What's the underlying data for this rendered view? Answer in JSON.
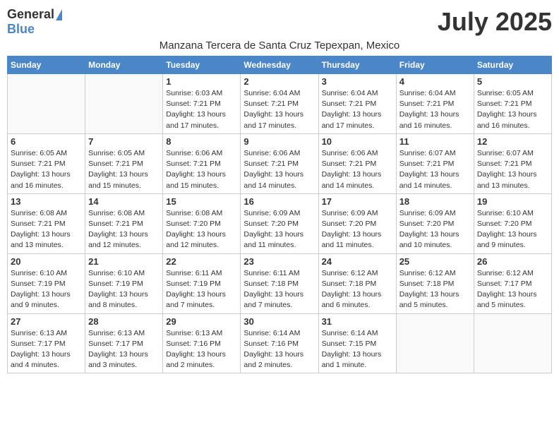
{
  "header": {
    "logo_general": "General",
    "logo_blue": "Blue",
    "month": "July 2025",
    "subtitle": "Manzana Tercera de Santa Cruz Tepexpan, Mexico"
  },
  "days_of_week": [
    "Sunday",
    "Monday",
    "Tuesday",
    "Wednesday",
    "Thursday",
    "Friday",
    "Saturday"
  ],
  "weeks": [
    [
      {
        "day": "",
        "info": ""
      },
      {
        "day": "",
        "info": ""
      },
      {
        "day": "1",
        "info": "Sunrise: 6:03 AM\nSunset: 7:21 PM\nDaylight: 13 hours\nand 17 minutes."
      },
      {
        "day": "2",
        "info": "Sunrise: 6:04 AM\nSunset: 7:21 PM\nDaylight: 13 hours\nand 17 minutes."
      },
      {
        "day": "3",
        "info": "Sunrise: 6:04 AM\nSunset: 7:21 PM\nDaylight: 13 hours\nand 17 minutes."
      },
      {
        "day": "4",
        "info": "Sunrise: 6:04 AM\nSunset: 7:21 PM\nDaylight: 13 hours\nand 16 minutes."
      },
      {
        "day": "5",
        "info": "Sunrise: 6:05 AM\nSunset: 7:21 PM\nDaylight: 13 hours\nand 16 minutes."
      }
    ],
    [
      {
        "day": "6",
        "info": "Sunrise: 6:05 AM\nSunset: 7:21 PM\nDaylight: 13 hours\nand 16 minutes."
      },
      {
        "day": "7",
        "info": "Sunrise: 6:05 AM\nSunset: 7:21 PM\nDaylight: 13 hours\nand 15 minutes."
      },
      {
        "day": "8",
        "info": "Sunrise: 6:06 AM\nSunset: 7:21 PM\nDaylight: 13 hours\nand 15 minutes."
      },
      {
        "day": "9",
        "info": "Sunrise: 6:06 AM\nSunset: 7:21 PM\nDaylight: 13 hours\nand 14 minutes."
      },
      {
        "day": "10",
        "info": "Sunrise: 6:06 AM\nSunset: 7:21 PM\nDaylight: 13 hours\nand 14 minutes."
      },
      {
        "day": "11",
        "info": "Sunrise: 6:07 AM\nSunset: 7:21 PM\nDaylight: 13 hours\nand 14 minutes."
      },
      {
        "day": "12",
        "info": "Sunrise: 6:07 AM\nSunset: 7:21 PM\nDaylight: 13 hours\nand 13 minutes."
      }
    ],
    [
      {
        "day": "13",
        "info": "Sunrise: 6:08 AM\nSunset: 7:21 PM\nDaylight: 13 hours\nand 13 minutes."
      },
      {
        "day": "14",
        "info": "Sunrise: 6:08 AM\nSunset: 7:21 PM\nDaylight: 13 hours\nand 12 minutes."
      },
      {
        "day": "15",
        "info": "Sunrise: 6:08 AM\nSunset: 7:20 PM\nDaylight: 13 hours\nand 12 minutes."
      },
      {
        "day": "16",
        "info": "Sunrise: 6:09 AM\nSunset: 7:20 PM\nDaylight: 13 hours\nand 11 minutes."
      },
      {
        "day": "17",
        "info": "Sunrise: 6:09 AM\nSunset: 7:20 PM\nDaylight: 13 hours\nand 11 minutes."
      },
      {
        "day": "18",
        "info": "Sunrise: 6:09 AM\nSunset: 7:20 PM\nDaylight: 13 hours\nand 10 minutes."
      },
      {
        "day": "19",
        "info": "Sunrise: 6:10 AM\nSunset: 7:20 PM\nDaylight: 13 hours\nand 9 minutes."
      }
    ],
    [
      {
        "day": "20",
        "info": "Sunrise: 6:10 AM\nSunset: 7:19 PM\nDaylight: 13 hours\nand 9 minutes."
      },
      {
        "day": "21",
        "info": "Sunrise: 6:10 AM\nSunset: 7:19 PM\nDaylight: 13 hours\nand 8 minutes."
      },
      {
        "day": "22",
        "info": "Sunrise: 6:11 AM\nSunset: 7:19 PM\nDaylight: 13 hours\nand 7 minutes."
      },
      {
        "day": "23",
        "info": "Sunrise: 6:11 AM\nSunset: 7:18 PM\nDaylight: 13 hours\nand 7 minutes."
      },
      {
        "day": "24",
        "info": "Sunrise: 6:12 AM\nSunset: 7:18 PM\nDaylight: 13 hours\nand 6 minutes."
      },
      {
        "day": "25",
        "info": "Sunrise: 6:12 AM\nSunset: 7:18 PM\nDaylight: 13 hours\nand 5 minutes."
      },
      {
        "day": "26",
        "info": "Sunrise: 6:12 AM\nSunset: 7:17 PM\nDaylight: 13 hours\nand 5 minutes."
      }
    ],
    [
      {
        "day": "27",
        "info": "Sunrise: 6:13 AM\nSunset: 7:17 PM\nDaylight: 13 hours\nand 4 minutes."
      },
      {
        "day": "28",
        "info": "Sunrise: 6:13 AM\nSunset: 7:17 PM\nDaylight: 13 hours\nand 3 minutes."
      },
      {
        "day": "29",
        "info": "Sunrise: 6:13 AM\nSunset: 7:16 PM\nDaylight: 13 hours\nand 2 minutes."
      },
      {
        "day": "30",
        "info": "Sunrise: 6:14 AM\nSunset: 7:16 PM\nDaylight: 13 hours\nand 2 minutes."
      },
      {
        "day": "31",
        "info": "Sunrise: 6:14 AM\nSunset: 7:15 PM\nDaylight: 13 hours\nand 1 minute."
      },
      {
        "day": "",
        "info": ""
      },
      {
        "day": "",
        "info": ""
      }
    ]
  ]
}
